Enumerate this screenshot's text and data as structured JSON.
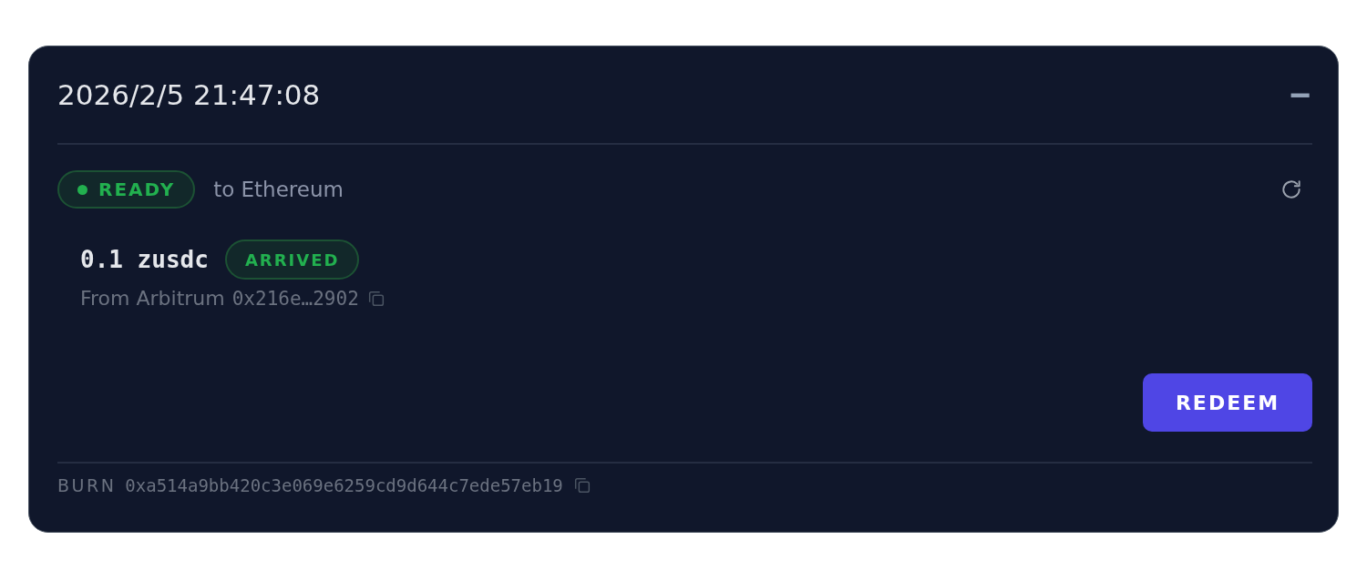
{
  "card": {
    "title": "2026/2/5 21:47:08",
    "collapse_icon": "−"
  },
  "status": {
    "label": "READY",
    "kind": "success",
    "destination": "to Ethereum"
  },
  "transfer": {
    "amount": "0.1 zusdc",
    "badge": {
      "label": "ARRIVED",
      "kind": "success"
    },
    "source": "From Arbitrum",
    "address": "0x216e…2902"
  },
  "action": {
    "label": "REDEEM"
  },
  "footer": {
    "label": "BURN",
    "hash": "0xa514a9bb420c3e069e6259cd9d644c7ede57eb19"
  }
}
